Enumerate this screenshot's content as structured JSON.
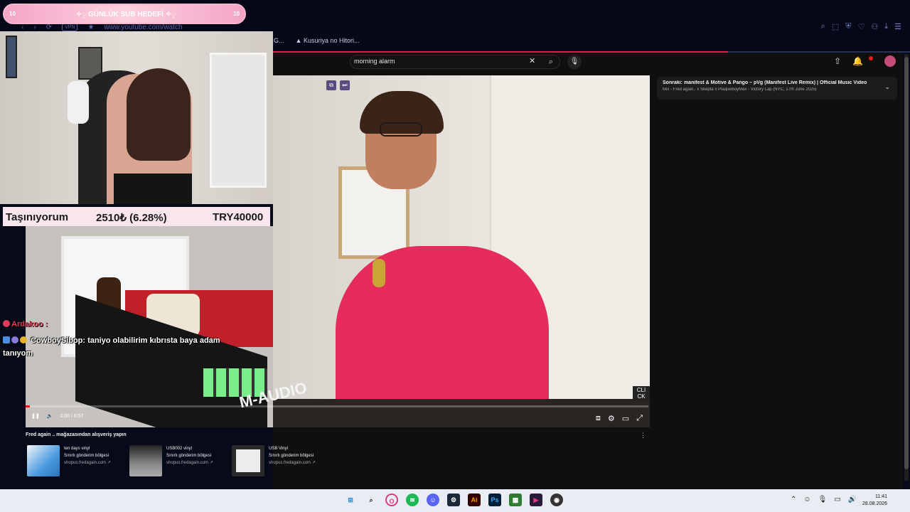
{
  "overlay": {
    "banner_text": "✧◌̥ GÜNLÜK SUB HEDEFİ ✧◌̥",
    "banner_left": "10",
    "banner_right": "10",
    "stock": {
      "name": "Taşınıyorum",
      "change": "2510₺ (6.28%)",
      "total": "TRY40000"
    },
    "chat": [
      {
        "user": "Ardakoo :",
        "message": ""
      },
      {
        "user": "CowboySibop",
        "message": ": taniyo olabilirim kıbrısta baya adam",
        "continuation": "tanıyom"
      }
    ]
  },
  "browser": {
    "url": "www.youtube.com/watch",
    "vpn_label": "VPN",
    "tabs": [
      "G...",
      "Kusuriya no Hitori..."
    ]
  },
  "youtube": {
    "search_value": "morning alarm",
    "up_next": {
      "title": "Sonraki: manifest & Motive & Pango – pVg (Manifest Live Remix) | Official Music Video",
      "subtitle": "Mix - Fred again.. x Skepta x PlaqueBoyMax - Victory Lap (NYC, 17th June 2025)"
    },
    "player": {
      "time": "0:00 / 0:57",
      "watermark": "CLI CK"
    },
    "shelf": {
      "title": "Fred again .. mağazasından alışveriş yapın",
      "items": [
        {
          "name": "ten days vinyl",
          "note": "Sınırlı gönderim bölgesi",
          "link": "shopus.fredagain.com",
          "color": "#3c8ed0"
        },
        {
          "name": "USB002 vinyl",
          "note": "Sınırlı gönderim bölgesi",
          "link": "shopus.fredagain.com",
          "color": "#6b6b6b"
        },
        {
          "name": "USB Vinyl",
          "note": "Sınırlı gönderim bölgesi",
          "link": "shopus.fredagain.com",
          "color": "#e9e9e9"
        }
      ]
    }
  },
  "video_scene": {
    "brand_label": "M-AUDIO"
  },
  "taskbar": {
    "time": "11:41",
    "date": "28.08.2026"
  },
  "colors": {
    "accent": "#e81a4b",
    "banner_pink": "#f4a5c4",
    "robe": "#e52c5c"
  }
}
